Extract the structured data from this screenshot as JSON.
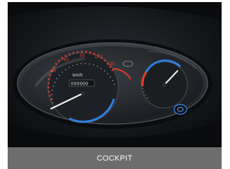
{
  "caption": "COCKPIT",
  "speedometer": {
    "unit": "km/h",
    "odometer": "000000"
  },
  "colors": {
    "caption_bg": "#6d6d6d",
    "caption_text": "#ffffff",
    "needle_red": "#e23a2a",
    "arc_blue": "#2f7fe0",
    "background": "#0d0f11"
  }
}
